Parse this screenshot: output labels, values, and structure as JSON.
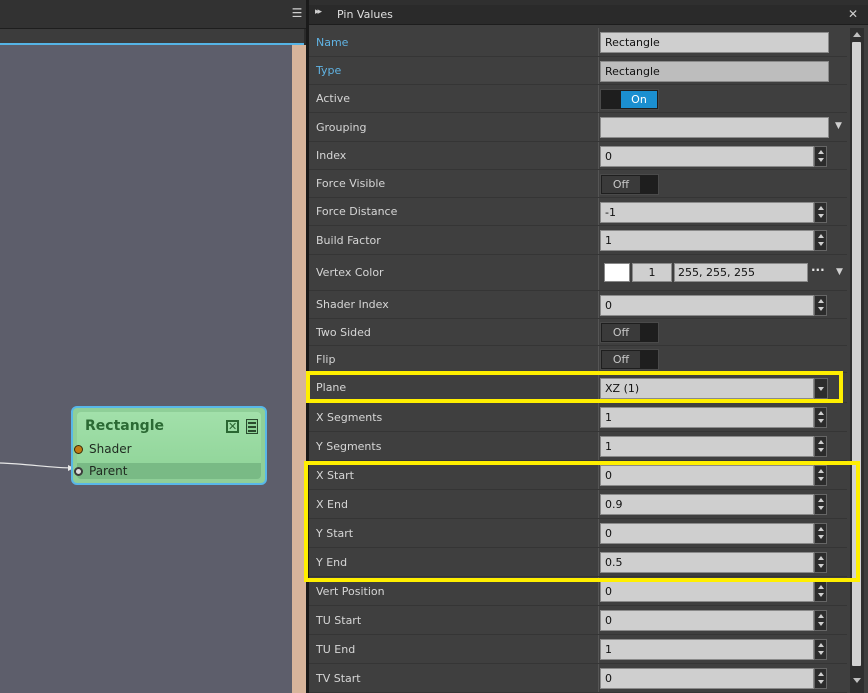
{
  "panel": {
    "title": "Pin Values",
    "menu_glyph": "☰",
    "close_glyph": "✕",
    "collapse_glyph": "▸▸"
  },
  "node": {
    "title": "Rectangle",
    "pins": [
      {
        "label": "Shader",
        "color": "#c27a14"
      },
      {
        "label": "Parent",
        "color": "#dcdcdc"
      }
    ],
    "close_glyph": "✕"
  },
  "rows": [
    {
      "label": "Name",
      "blue": true,
      "kind": "text",
      "value": "Rectangle"
    },
    {
      "label": "Type",
      "blue": true,
      "kind": "text-dark",
      "value": "Rectangle"
    },
    {
      "label": "Active",
      "kind": "toggle",
      "value": "On"
    },
    {
      "label": "Grouping",
      "kind": "dropdown",
      "value": ""
    },
    {
      "label": "Index",
      "kind": "spin",
      "value": "0"
    },
    {
      "label": "Force Visible",
      "kind": "toggle",
      "value": "Off"
    },
    {
      "label": "Force Distance",
      "kind": "spin",
      "value": "-1"
    },
    {
      "label": "Build Factor",
      "kind": "spin",
      "value": "1"
    },
    {
      "label": "Vertex Color",
      "kind": "color",
      "alpha": "1",
      "rgb": "255, 255, 255",
      "dots": "···"
    },
    {
      "label": "Shader Index",
      "kind": "spin",
      "value": "0"
    },
    {
      "label": "Two Sided",
      "kind": "toggle",
      "value": "Off"
    },
    {
      "label": "Flip",
      "kind": "toggle",
      "value": "Off"
    },
    {
      "label": "Plane",
      "kind": "combo",
      "value": "XZ (1)"
    },
    {
      "label": "X Segments",
      "kind": "spin",
      "value": "1"
    },
    {
      "label": "Y Segments",
      "kind": "spin",
      "value": "1"
    },
    {
      "label": "X Start",
      "kind": "spin",
      "value": "0"
    },
    {
      "label": "X End",
      "kind": "spin",
      "value": "0.9"
    },
    {
      "label": "Y Start",
      "kind": "spin",
      "value": "0"
    },
    {
      "label": "Y End",
      "kind": "spin",
      "value": "0.5"
    },
    {
      "label": "Vert Position",
      "kind": "spin",
      "value": "0"
    },
    {
      "label": "TU Start",
      "kind": "spin",
      "value": "0"
    },
    {
      "label": "TU End",
      "kind": "spin",
      "value": "1"
    },
    {
      "label": "TV Start",
      "kind": "spin",
      "value": "0"
    }
  ],
  "colors": {
    "highlight": "#ffef00",
    "toggle_on": "#1b8fd0",
    "node_border": "#58b7e8",
    "label_blue": "#60b3e3"
  }
}
